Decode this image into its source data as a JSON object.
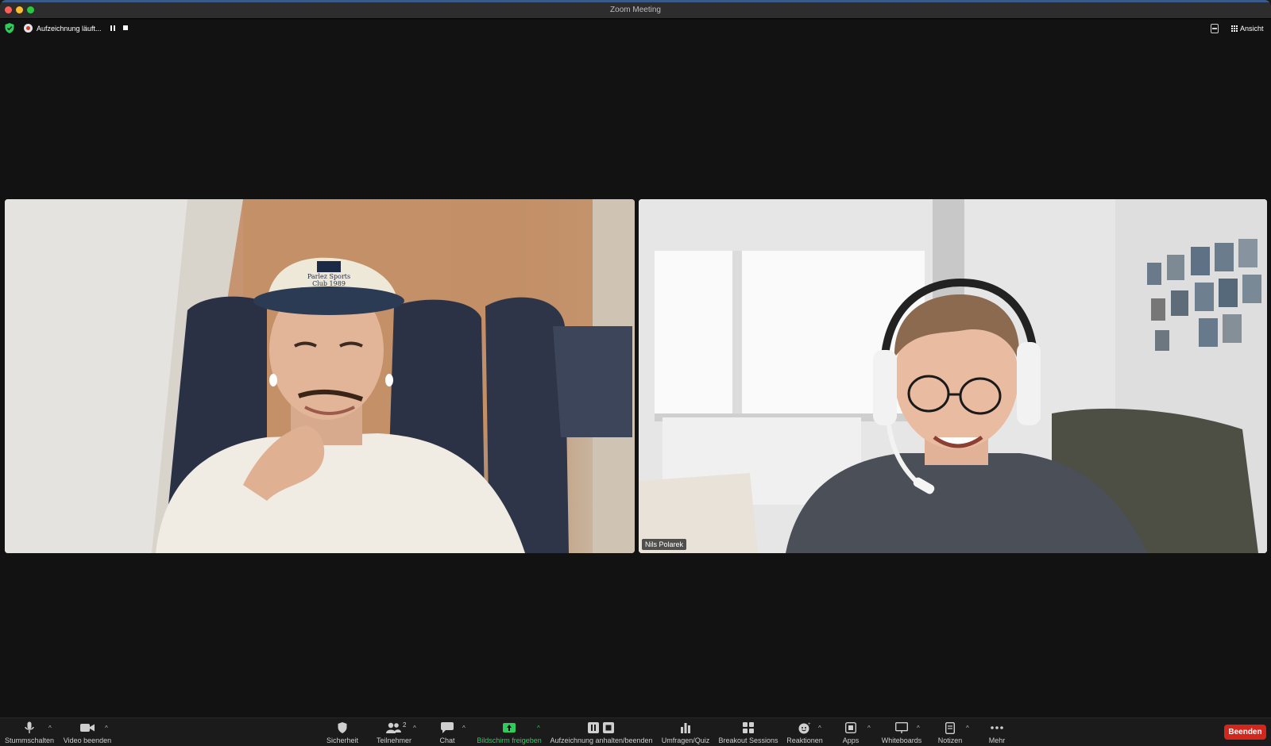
{
  "window": {
    "title": "Zoom Meeting"
  },
  "status": {
    "recording_text": "Aufzeichnung läuft...",
    "view_label": "Ansicht"
  },
  "participants": {
    "right_name": "Nils Polarek",
    "left_cap_text_1": "Parlez Sports",
    "left_cap_text_2": "Club 1989",
    "participant_count": "2"
  },
  "toolbar": {
    "mute": "Stummschalten",
    "video": "Video beenden",
    "security": "Sicherheit",
    "participants": "Teilnehmer",
    "chat": "Chat",
    "share": "Bildschirm freigeben",
    "recording": "Aufzeichnung anhalten/beenden",
    "polls": "Umfragen/Quiz",
    "breakout": "Breakout Sessions",
    "reactions": "Reaktionen",
    "apps": "Apps",
    "whiteboards": "Whiteboards",
    "notes": "Notizen",
    "more": "Mehr",
    "end": "Beenden"
  },
  "colors": {
    "share_green": "#2ecc5b",
    "end_red": "#d1271d",
    "rec_red": "#e0382e"
  }
}
